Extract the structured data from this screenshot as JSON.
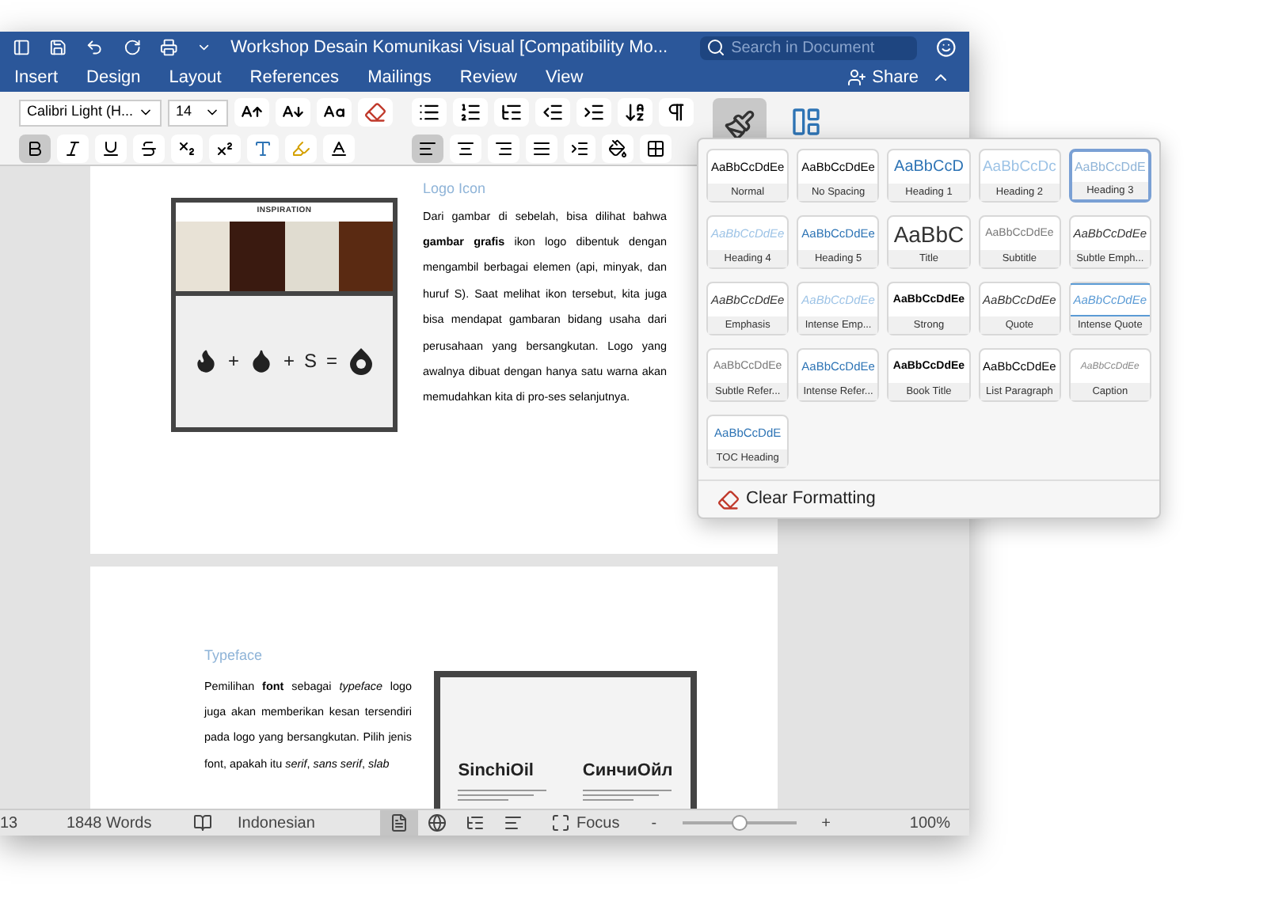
{
  "window": {
    "title": "Workshop Desain Komunikasi Visual [Compatibility Mo...",
    "search": {
      "placeholder": "Search in Document"
    }
  },
  "ribbon_tabs": [
    {
      "label": "Insert",
      "selected": false
    },
    {
      "label": "Design",
      "selected": false
    },
    {
      "label": "Layout",
      "selected": false
    },
    {
      "label": "References",
      "selected": false
    },
    {
      "label": "Mailings",
      "selected": false
    },
    {
      "label": "Review",
      "selected": false
    },
    {
      "label": "View",
      "selected": false
    }
  ],
  "share": "Share",
  "toolbar": {
    "font": "Calibri Light (H...",
    "size": "14",
    "format_buttons": [
      {
        "kind": "bold",
        "selected": true
      },
      {
        "kind": "italic",
        "selected": false
      },
      {
        "kind": "underline",
        "selected": false
      },
      {
        "kind": "strike",
        "selected": false
      },
      {
        "kind": "subscript",
        "selected": false
      },
      {
        "kind": "superscript",
        "selected": false
      }
    ],
    "align_buttons": [
      {
        "kind": "left",
        "selected": true
      },
      {
        "kind": "center",
        "selected": false
      },
      {
        "kind": "right",
        "selected": false
      },
      {
        "kind": "justify",
        "selected": false
      }
    ],
    "styles_button": {
      "selected": true
    }
  },
  "styles_gallery": {
    "items": [
      {
        "preview": "AaBbCcDdEe",
        "name": "Normal",
        "kind": "plain",
        "selected": false
      },
      {
        "preview": "AaBbCcDdEe",
        "name": "No Spacing",
        "kind": "plain",
        "selected": false
      },
      {
        "preview": "AaBbCcD",
        "name": "Heading 1",
        "kind": "large",
        "selected": false
      },
      {
        "preview": "AaBbCcDc",
        "name": "Heading 2",
        "kind": "light",
        "selected": false
      },
      {
        "preview": "AaBbCcDdE",
        "name": "Heading 3",
        "kind": "pale",
        "selected": true
      },
      {
        "preview": "AaBbCcDdEe",
        "name": "Heading 4",
        "kind": "paleitalic",
        "selected": false
      },
      {
        "preview": "AaBbCcDdEe",
        "name": "Heading 5",
        "kind": "blue",
        "selected": false
      },
      {
        "preview": "AaBbC",
        "name": "Title",
        "kind": "title",
        "selected": false
      },
      {
        "preview": "AaBbCcDdEe",
        "name": "Subtitle",
        "kind": "grey",
        "selected": false
      },
      {
        "preview": "AaBbCcDdEe",
        "name": "Subtle Emph...",
        "kind": "italic",
        "selected": false
      },
      {
        "preview": "AaBbCcDdEe",
        "name": "Emphasis",
        "kind": "italic",
        "selected": false
      },
      {
        "preview": "AaBbCcDdEe",
        "name": "Intense Emp...",
        "kind": "paleitalic",
        "selected": false
      },
      {
        "preview": "AaBbCcDdEe",
        "name": "Strong",
        "kind": "strong",
        "selected": false
      },
      {
        "preview": "AaBbCcDdEe",
        "name": "Quote",
        "kind": "italic",
        "selected": false
      },
      {
        "preview": "AaBbCcDdEe",
        "name": "Intense Quote",
        "kind": "quote",
        "selected": false
      },
      {
        "preview": "AaBbCcDdEe",
        "name": "Subtle Refer...",
        "kind": "grey",
        "selected": false
      },
      {
        "preview": "AaBbCcDdEe",
        "name": "Intense Refer...",
        "kind": "blue",
        "selected": false
      },
      {
        "preview": "AaBbCcDdEe",
        "name": "Book Title",
        "kind": "strong",
        "selected": false
      },
      {
        "preview": "AaBbCcDdEe",
        "name": "List Paragraph",
        "kind": "plain",
        "selected": false
      },
      {
        "preview": "AaBbCcDdEe",
        "name": "Caption",
        "kind": "tiny",
        "selected": false
      },
      {
        "preview": "AaBbCcDdE",
        "name": "TOC Heading",
        "kind": "blue",
        "selected": false
      }
    ],
    "clear": "Clear Formatting"
  },
  "pages": [
    {
      "heading": "Logo Icon",
      "figure": {
        "kind": "inspiration",
        "caption": "INSPIRATION",
        "formula": [
          {
            "kind": "flame"
          },
          {
            "kind": "text",
            "text": "+"
          },
          {
            "kind": "drop"
          },
          {
            "kind": "text",
            "text": "+"
          },
          {
            "kind": "text",
            "text": "S"
          },
          {
            "kind": "text",
            "text": "="
          },
          {
            "kind": "logo"
          }
        ]
      },
      "paragraph": "Dari gambar di sebelah, bisa dilihat bahwa **gambar grafis** ikon logo dibentuk dengan mengambil berbagai elemen (api, minyak, dan huruf S). Saat melihat ikon tersebut, kita juga bisa mendapat gambaran bidang usaha dari perusahaan yang bersangkutan. Logo yang awalnya dibuat dengan hanya satu warna akan memudahkan kita di pro-ses selanjutnya."
    },
    {
      "heading": "Typeface",
      "figure": {
        "kind": "typeface",
        "samples": [
          "SinchiOil",
          "СинчиОйл"
        ]
      },
      "paragraph": "Pemilihan **font** sebagai *typeface* logo juga akan memberikan kesan tersendiri pada logo yang bersangkutan. Pilih jenis font, apakah itu *serif*, *sans serif*, *slab*"
    }
  ],
  "status_bar": {
    "page": "13",
    "words": "1848 Words",
    "language": "Indonesian",
    "views": [
      {
        "kind": "print",
        "selected": true
      },
      {
        "kind": "web",
        "selected": false
      },
      {
        "kind": "outline",
        "selected": false
      },
      {
        "kind": "draft",
        "selected": false
      }
    ],
    "focus": "Focus",
    "zoom_out": "-",
    "zoom_in": "+",
    "zoom": {
      "level": 0.5
    },
    "zoom_text": "100%"
  }
}
